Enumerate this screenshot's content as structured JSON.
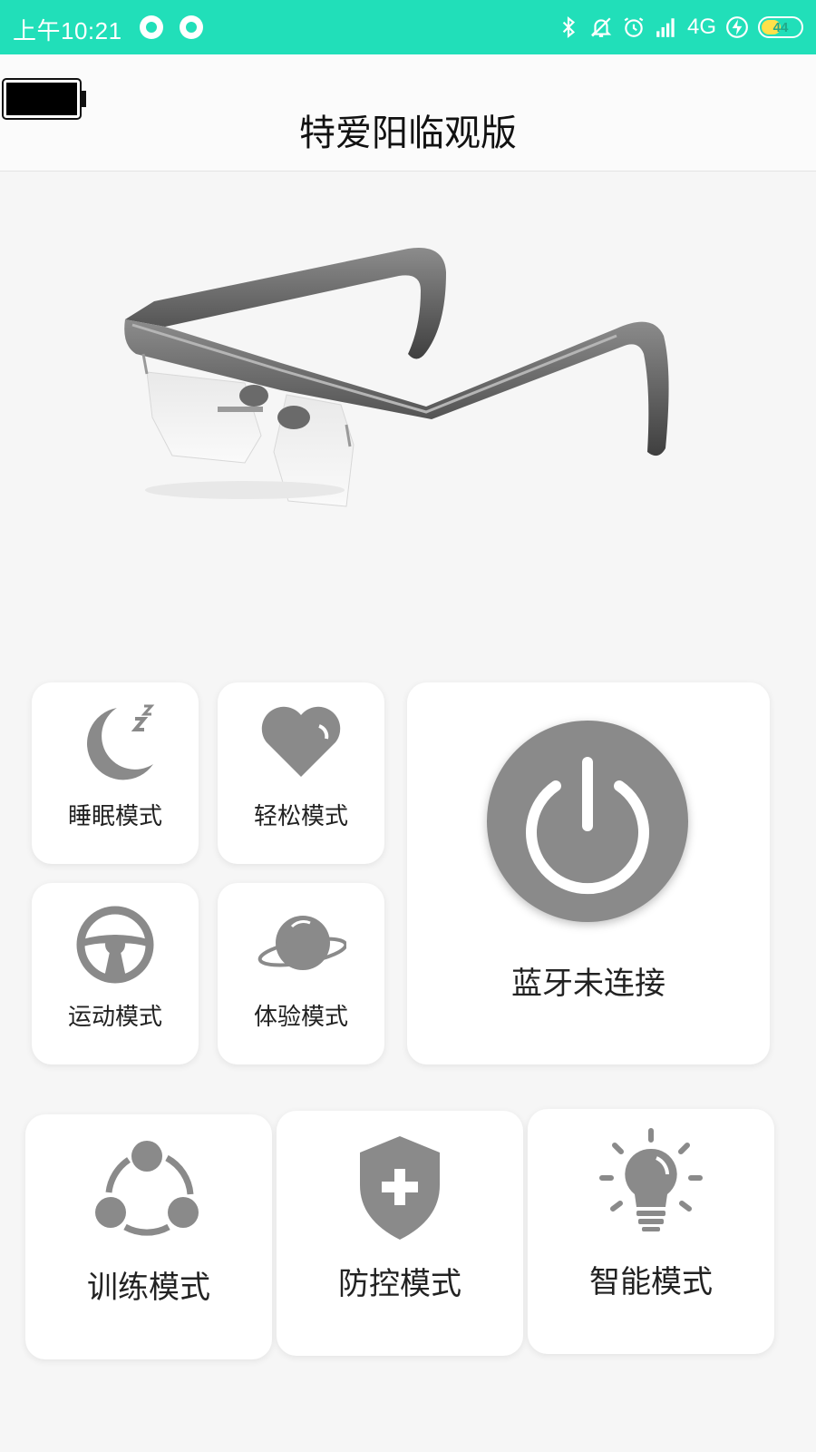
{
  "status_bar": {
    "time": "上午10:21",
    "network": "4G",
    "battery": "44",
    "color": "#21dfb9"
  },
  "header": {
    "title": "特爱阳临观版"
  },
  "modes": {
    "sleep": {
      "label": "睡眠模式",
      "icon": "moon-zzz-icon"
    },
    "relax": {
      "label": "轻松模式",
      "icon": "heart-icon"
    },
    "sport": {
      "label": "运动模式",
      "icon": "steering-wheel-icon"
    },
    "experience": {
      "label": "体验模式",
      "icon": "planet-icon"
    },
    "training": {
      "label": "训练模式",
      "icon": "share-nodes-icon"
    },
    "prevention": {
      "label": "防控模式",
      "icon": "shield-plus-icon"
    },
    "smart": {
      "label": "智能模式",
      "icon": "lightbulb-icon"
    }
  },
  "bluetooth": {
    "status": "蓝牙未连接",
    "icon": "power-icon"
  },
  "icon_color": "#8a8a8a"
}
